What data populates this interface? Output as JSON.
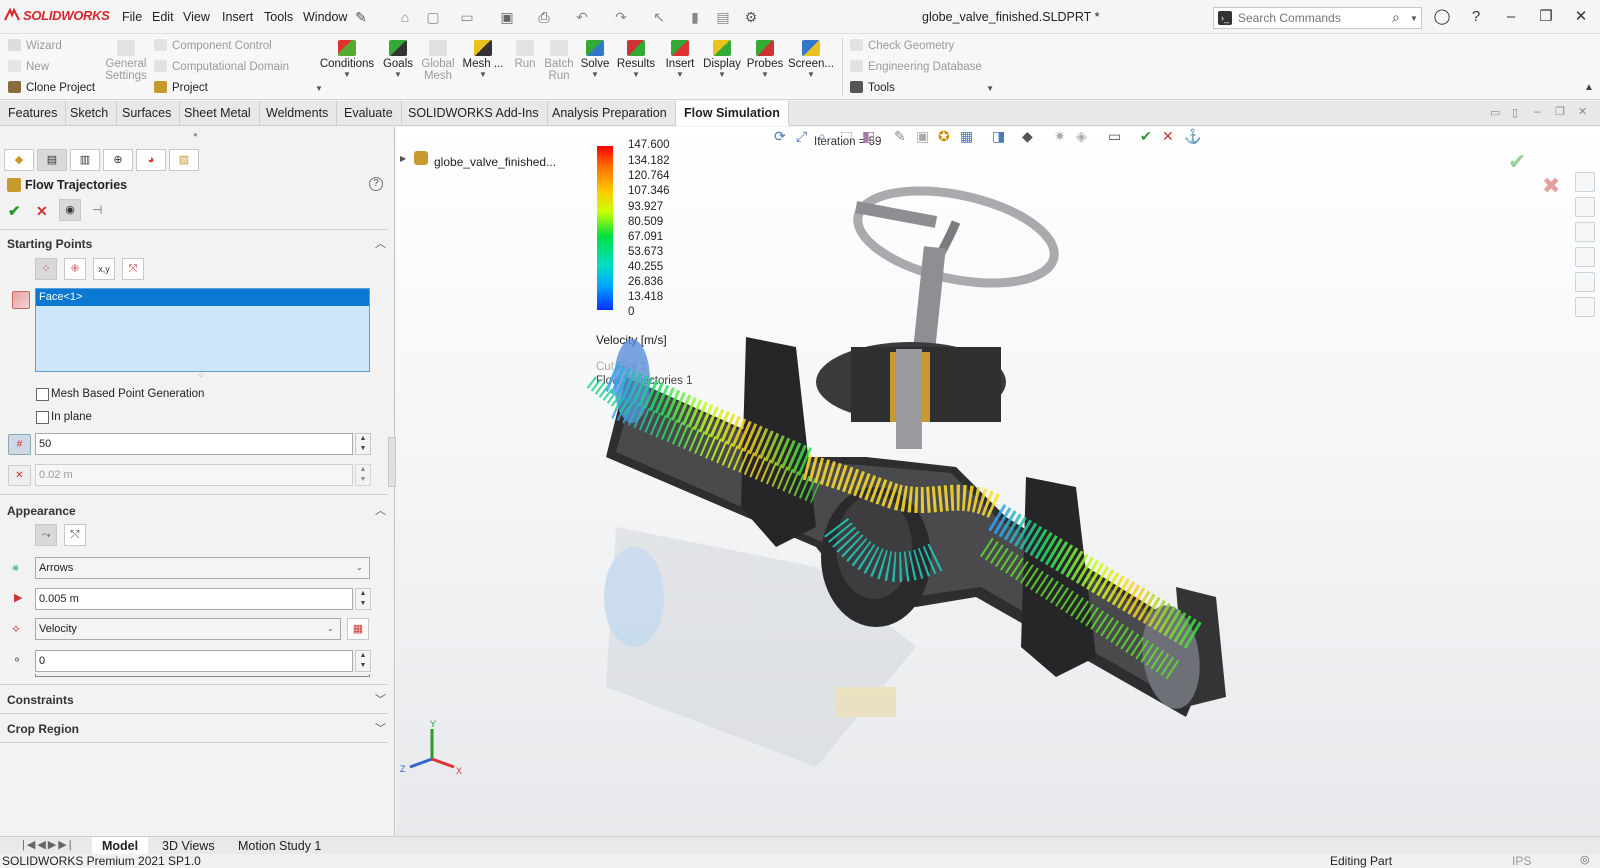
{
  "app": {
    "logo_text": "SOLIDWORKS",
    "document_title": "globe_valve_finished.SLDPRT *",
    "menu": [
      "File",
      "Edit",
      "View",
      "Insert",
      "Tools",
      "Window"
    ],
    "search_placeholder": "Search Commands"
  },
  "ribbon": {
    "left_small": [
      "Wizard",
      "New",
      "Clone Project"
    ],
    "general_settings": "General Settings",
    "mid_small": [
      "Component Control",
      "Computational Domain",
      "Project"
    ],
    "big_buttons": [
      {
        "label": "Conditions",
        "enabled": true
      },
      {
        "label": "Goals",
        "enabled": true
      },
      {
        "label": "Global Mesh",
        "enabled": false
      },
      {
        "label": "Mesh ...",
        "enabled": true
      },
      {
        "label": "Run",
        "enabled": false
      },
      {
        "label": "Batch Run",
        "enabled": false
      },
      {
        "label": "Solve",
        "enabled": true
      },
      {
        "label": "Results",
        "enabled": true
      },
      {
        "label": "Insert",
        "enabled": true
      },
      {
        "label": "Display",
        "enabled": true
      },
      {
        "label": "Probes",
        "enabled": true
      },
      {
        "label": "Screen...",
        "enabled": true
      }
    ],
    "right_small": [
      "Check Geometry",
      "Engineering Database",
      "Tools"
    ]
  },
  "tabs": [
    "Features",
    "Sketch",
    "Surfaces",
    "Sheet Metal",
    "Weldments",
    "Evaluate",
    "SOLIDWORKS Add-Ins",
    "Analysis Preparation",
    "Flow Simulation"
  ],
  "active_tab": "Flow Simulation",
  "panel": {
    "title": "Flow Trajectories",
    "starting_points": {
      "header": "Starting Points",
      "selection": "Face<1>",
      "mesh_based_label": "Mesh Based Point Generation",
      "in_plane_label": "In plane",
      "count_value": "50",
      "spacing_value": "0.02 m"
    },
    "appearance": {
      "header": "Appearance",
      "style": "Arrows",
      "size_value": "0.005 m",
      "color_by": "Velocity",
      "last_value": "0"
    },
    "constraints_header": "Constraints",
    "crop_header": "Crop Region"
  },
  "viewport": {
    "tree_item": "globe_valve_finished...",
    "iteration_text": "Iteration = 59",
    "legend_values": [
      "147.600",
      "134.182",
      "120.764",
      "107.346",
      "93.927",
      "80.509",
      "67.091",
      "53.673",
      "40.255",
      "26.836",
      "13.418",
      "0"
    ],
    "legend_title": "Velocity [m/s]",
    "overlay_texts": [
      "Cut Plot 1",
      "Flow Trajectories 1"
    ],
    "axis_labels": {
      "x": "X",
      "y": "Y",
      "z": "Z"
    }
  },
  "bottom_tabs": [
    "Model",
    "3D Views",
    "Motion Study 1"
  ],
  "active_bottom_tab": "Model",
  "status": {
    "left": "SOLIDWORKS Premium 2021 SP1.0",
    "right": "Editing Part",
    "units": "IPS"
  },
  "colors": {
    "brand": "#d6262e",
    "selection": "#0b78d4",
    "legend_gradient": [
      "#ff0000",
      "#ff8c00",
      "#ffff00",
      "#00ff00",
      "#00ffff",
      "#0040ff"
    ]
  }
}
